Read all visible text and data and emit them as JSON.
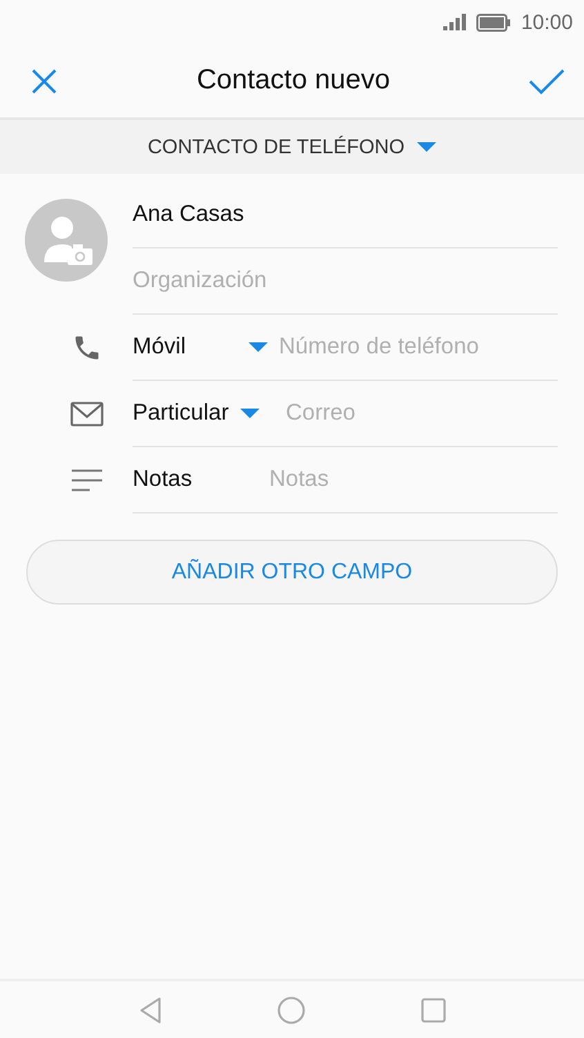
{
  "status_bar": {
    "time": "10:00"
  },
  "header": {
    "title": "Contacto nuevo"
  },
  "account": {
    "label": "CONTACTO DE TELÉFONO"
  },
  "fields": [
    {
      "kind": "name",
      "value": "Ana Casas"
    },
    {
      "kind": "organization",
      "placeholder": "Organización"
    },
    {
      "kind": "phone",
      "label": "Móvil",
      "dropdown": true,
      "placeholder": "Número de teléfono"
    },
    {
      "kind": "email",
      "label": "Particular",
      "dropdown": true,
      "placeholder": "Correo"
    },
    {
      "kind": "notes",
      "label": "Notas",
      "dropdown": false,
      "placeholder": "Notas"
    }
  ],
  "add_button": {
    "label": "AÑADIR OTRO CAMPO"
  }
}
